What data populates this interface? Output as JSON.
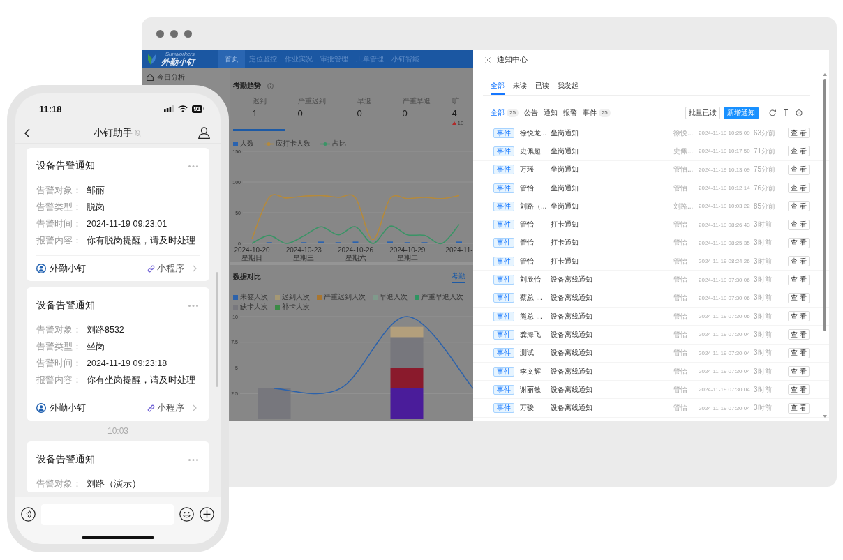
{
  "browser_window": {
    "dashboard": {
      "header": {
        "logo_subtitle": "Sunworkers",
        "logo_title": "外勤小钉",
        "nav": [
          {
            "label": "首页",
            "selected": true
          },
          {
            "label": "定位监控",
            "selected": false
          },
          {
            "label": "作业实况",
            "selected": false
          },
          {
            "label": "审批管理",
            "selected": false
          },
          {
            "label": "工单管理",
            "selected": false
          },
          {
            "label": "小钉智能",
            "selected": false
          }
        ]
      },
      "sidebar": {
        "items": [
          {
            "label": "今日分析"
          }
        ]
      },
      "attendance_trend": {
        "title": "考勤趋势",
        "stats": [
          {
            "label": "迟到",
            "value": "1",
            "selected": true
          },
          {
            "label": "严重迟到",
            "value": "0",
            "selected": false
          },
          {
            "label": "早退",
            "value": "0",
            "selected": false
          },
          {
            "label": "严重早退",
            "value": "0",
            "selected": false
          },
          {
            "label": "旷",
            "value": "4",
            "selected": false,
            "change": "10"
          }
        ],
        "chart_data": {
          "type": "line",
          "grid": true,
          "categories": [
            "2024-10-20 星期日",
            null,
            null,
            "2024-10-23 星期三",
            null,
            null,
            "2024-10-26 星期六",
            null,
            null,
            "2024-10-29 星期二",
            null,
            null,
            "2024-11-"
          ],
          "ylim": [
            0,
            150
          ],
          "yticks": [
            0,
            50,
            100,
            150
          ],
          "series": [
            {
              "name": "人数",
              "type": "bar",
              "color": "#2a63b0",
              "values": [
                0,
                2,
                0,
                2,
                3,
                2,
                3,
                0,
                3,
                2,
                2,
                0,
                3
              ]
            },
            {
              "name": "应打卡人数",
              "color": "#b58a3c",
              "values": [
                7,
                75,
                74,
                77,
                78,
                75,
                74,
                6,
                73,
                73,
                75,
                73,
                78
              ]
            },
            {
              "name": "占比",
              "color": "#3a9466",
              "values": [
                0,
                13,
                0,
                12,
                27,
                14,
                27,
                0,
                28,
                14,
                13,
                0,
                31
              ]
            }
          ]
        }
      },
      "data_comparison": {
        "title": "数据对比",
        "tabs": [
          {
            "label": "考勤",
            "selected": true
          }
        ],
        "chart_data": {
          "type": "bar",
          "stacked": true,
          "grid": true,
          "ylim": [
            0,
            10
          ],
          "yticks": [
            2.5,
            5,
            7.5,
            10
          ],
          "series": [
            {
              "name": "未签人次",
              "type": "line",
              "color": "#2c62ab",
              "values": [
                3,
                3,
                10,
                3
              ]
            },
            {
              "color": "#4a1c9a",
              "values": [
                0,
                0,
                3,
                0
              ]
            },
            {
              "color": "#8a1a2c",
              "values": [
                0,
                0,
                2,
                0
              ]
            },
            {
              "name": "迟到人次",
              "color": "#a59874",
              "values": [
                0,
                0,
                0,
                0
              ]
            },
            {
              "name": "严重迟到人次",
              "color": "#a8752f",
              "values": [
                0,
                0,
                0,
                0
              ]
            },
            {
              "name": "早退人次",
              "color": "#7f9a8b",
              "values": [
                0,
                0,
                0,
                0
              ]
            },
            {
              "name": "严重早退人次",
              "color": "#2e9461",
              "values": [
                0,
                0,
                0,
                0
              ]
            },
            {
              "name": "缺卡人次",
              "color": "#77777d",
              "values": [
                3,
                0,
                3,
                0
              ]
            },
            {
              "name": "补卡人次",
              "color": "#3a8a45",
              "values": [
                0,
                0,
                0,
                0
              ]
            },
            {
              "color": "#b39f7c",
              "values": [
                0,
                0,
                1,
                0
              ]
            }
          ]
        }
      }
    },
    "notification_center": {
      "title": "通知中心",
      "tabs": [
        {
          "label": "全部",
          "selected": true
        },
        {
          "label": "未读",
          "selected": false
        },
        {
          "label": "已读",
          "selected": false
        },
        {
          "label": "我发起",
          "selected": false
        }
      ],
      "filters": [
        {
          "label": "全部",
          "count": "25",
          "selected": true
        },
        {
          "label": "公告",
          "selected": false
        },
        {
          "label": "通知",
          "selected": false
        },
        {
          "label": "报警",
          "selected": false
        },
        {
          "label": "事件",
          "count": "25",
          "selected": false
        }
      ],
      "buttons": [
        {
          "label": "批量已读",
          "kind": "default"
        },
        {
          "label": "新增通知",
          "kind": "primary"
        }
      ],
      "rows": [
        {
          "tag": "事件",
          "name": "徐悦龙...",
          "title": "坐岗通知",
          "sender": "徐悦...",
          "time": "2024-11-19 10:25:09",
          "ago": "63分前",
          "action": "查 看"
        },
        {
          "tag": "事件",
          "name": "史佩超",
          "title": "坐岗通知",
          "sender": "史佩...",
          "time": "2024-11-19 10:17:50",
          "ago": "71分前",
          "action": "查 看"
        },
        {
          "tag": "事件",
          "name": "万瑶",
          "title": "坐岗通知",
          "sender": "管怡...",
          "time": "2024-11-19 10:13:09",
          "ago": "75分前",
          "action": "查 看"
        },
        {
          "tag": "事件",
          "name": "管怡",
          "title": "坐岗通知",
          "sender": "管怡",
          "time": "2024-11-19 10:12:14",
          "ago": "76分前",
          "action": "查 看"
        },
        {
          "tag": "事件",
          "name": "刘路（...",
          "title": "坐岗通知",
          "sender": "刘路...",
          "time": "2024-11-19 10:03:22",
          "ago": "85分前",
          "action": "查 看"
        },
        {
          "tag": "事件",
          "name": "管怡",
          "title": "打卡通知",
          "sender": "管怡",
          "time": "2024-11-19 08:26:43",
          "ago": "3时前",
          "action": "查 看"
        },
        {
          "tag": "事件",
          "name": "管怡",
          "title": "打卡通知",
          "sender": "管怡",
          "time": "2024-11-19 08:25:35",
          "ago": "3时前",
          "action": "查 看"
        },
        {
          "tag": "事件",
          "name": "管怡",
          "title": "打卡通知",
          "sender": "管怡",
          "time": "2024-11-19 08:24:26",
          "ago": "3时前",
          "action": "查 看"
        },
        {
          "tag": "事件",
          "name": "刘欣怡",
          "title": "设备离线通知",
          "sender": "管怡",
          "time": "2024-11-19 07:30:06",
          "ago": "3时前",
          "action": "查 看"
        },
        {
          "tag": "事件",
          "name": "蔡总-...",
          "title": "设备离线通知",
          "sender": "管怡",
          "time": "2024-11-19 07:30:06",
          "ago": "3时前",
          "action": "查 看"
        },
        {
          "tag": "事件",
          "name": "熊总-...",
          "title": "设备离线通知",
          "sender": "管怡",
          "time": "2024-11-19 07:30:06",
          "ago": "3时前",
          "action": "查 看"
        },
        {
          "tag": "事件",
          "name": "龚海飞",
          "title": "设备离线通知",
          "sender": "管怡",
          "time": "2024-11-19 07:30:04",
          "ago": "3时前",
          "action": "查 看"
        },
        {
          "tag": "事件",
          "name": "测试",
          "title": "设备离线通知",
          "sender": "管怡",
          "time": "2024-11-19 07:30:04",
          "ago": "3时前",
          "action": "查 看"
        },
        {
          "tag": "事件",
          "name": "李文辉",
          "title": "设备离线通知",
          "sender": "管怡",
          "time": "2024-11-19 07:30:04",
          "ago": "3时前",
          "action": "查 看"
        },
        {
          "tag": "事件",
          "name": "谢丽敏",
          "title": "设备离线通知",
          "sender": "管怡",
          "time": "2024-11-19 07:30:04",
          "ago": "3时前",
          "action": "查 看"
        },
        {
          "tag": "事件",
          "name": "万骏",
          "title": "设备离线通知",
          "sender": "管怡",
          "time": "2024-11-19 07:30:04",
          "ago": "3时前",
          "action": "查 看"
        }
      ]
    }
  },
  "phone": {
    "status_time": "11:18",
    "battery": "91",
    "chat_title": "小钉助手",
    "muted": true,
    "messages": [
      {
        "kind": "card",
        "title": "设备告警通知",
        "fields": [
          {
            "label": "告警对象：",
            "value": "邹丽"
          },
          {
            "label": "告警类型：",
            "value": "脱岗"
          },
          {
            "label": "告警时间：",
            "value": "2024-11-19 09:23:01"
          },
          {
            "label": "报警内容：",
            "value": "你有脱岗提醒，请及时处理"
          }
        ],
        "source": "外勤小钉",
        "link": "小程序"
      },
      {
        "kind": "card",
        "title": "设备告警通知",
        "fields": [
          {
            "label": "告警对象：",
            "value": "刘路8532"
          },
          {
            "label": "告警类型：",
            "value": "坐岗"
          },
          {
            "label": "告警时间：",
            "value": "2024-11-19 09:23:18"
          },
          {
            "label": "报警内容：",
            "value": "你有坐岗提醒，请及时处理"
          }
        ],
        "source": "外勤小钉",
        "link": "小程序"
      },
      {
        "kind": "time",
        "text": "10:03"
      },
      {
        "kind": "card",
        "title": "设备告警通知",
        "fields": [
          {
            "label": "告警对象：",
            "value": "刘路（演示）"
          }
        ]
      }
    ]
  }
}
